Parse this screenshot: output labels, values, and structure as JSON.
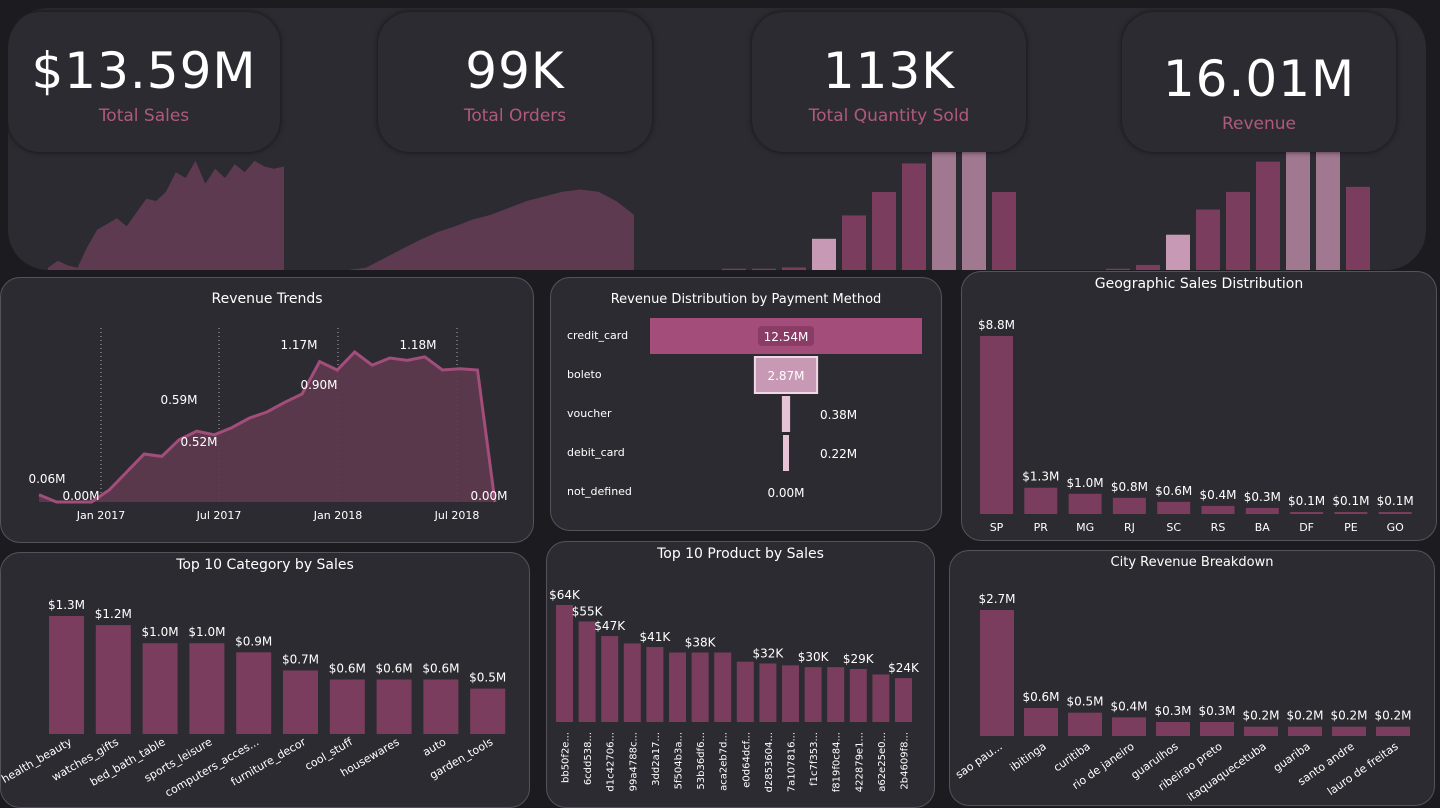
{
  "colors": {
    "bar": "#7a3d5e",
    "bar_light": "#b67d9e",
    "accent": "#b0597f",
    "area": "#5e3a50",
    "line": "#a24d7a",
    "panel": "#2c2b31"
  },
  "kpis": [
    {
      "value": "$13.59M",
      "label": "Total Sales"
    },
    {
      "value": "99K",
      "label": "Total Orders"
    },
    {
      "value": "113K",
      "label": "Total Quantity Sold"
    },
    {
      "value": "16.01M",
      "label": "Revenue"
    }
  ],
  "revenue_trends": {
    "title": "Revenue Trends",
    "x_ticks": [
      "Jan 2017",
      "Jul 2017",
      "Jan 2018",
      "Jul 2018"
    ],
    "points": [
      0.06,
      0.0,
      0.0,
      0.0,
      0.1,
      0.25,
      0.4,
      0.38,
      0.52,
      0.59,
      0.56,
      0.62,
      0.7,
      0.75,
      0.83,
      0.9,
      1.17,
      1.1,
      1.25,
      1.14,
      1.2,
      1.18,
      1.21,
      1.1,
      1.11,
      1.1,
      0.0
    ],
    "labels": [
      "0.06M",
      "0.00M",
      "0.59M",
      "0.52M",
      "1.17M",
      "0.90M",
      "1.18M",
      "0.00M"
    ]
  },
  "payment": {
    "title": "Revenue Distribution by Payment Method",
    "rows": [
      {
        "method": "credit_card",
        "value": 12.54,
        "label": "12.54M"
      },
      {
        "method": "boleto",
        "value": 2.87,
        "label": "2.87M"
      },
      {
        "method": "voucher",
        "value": 0.38,
        "label": "0.38M"
      },
      {
        "method": "debit_card",
        "value": 0.22,
        "label": "0.22M"
      },
      {
        "method": "not_defined",
        "value": 0.0,
        "label": "0.00M"
      }
    ]
  },
  "geo": {
    "title": "Geographic Sales Distribution",
    "categories": [
      "SP",
      "PR",
      "MG",
      "RJ",
      "SC",
      "RS",
      "BA",
      "DF",
      "PE",
      "GO"
    ],
    "values": [
      8.8,
      1.3,
      1.0,
      0.8,
      0.6,
      0.4,
      0.3,
      0.1,
      0.1,
      0.1
    ],
    "labels": [
      "$8.8M",
      "$1.3M",
      "$1.0M",
      "$0.8M",
      "$0.6M",
      "$0.4M",
      "$0.3M",
      "$0.1M",
      "$0.1M",
      "$0.1M"
    ]
  },
  "category": {
    "title": "Top 10 Category by Sales",
    "categories": [
      "health_beauty",
      "watches_gifts",
      "bed_bath_table",
      "sports_leisure",
      "computers_acces...",
      "furniture_decor",
      "cool_stuff",
      "housewares",
      "auto",
      "garden_tools"
    ],
    "values": [
      1.3,
      1.2,
      1.0,
      1.0,
      0.9,
      0.7,
      0.6,
      0.6,
      0.6,
      0.5
    ],
    "labels": [
      "$1.3M",
      "$1.2M",
      "$1.0M",
      "$1.0M",
      "$0.9M",
      "$0.7M",
      "$0.6M",
      "$0.6M",
      "$0.6M",
      "$0.5M"
    ]
  },
  "product": {
    "title": "Top 10 Product by Sales",
    "categories": [
      "bb50f2e...",
      "6cdd538...",
      "d1c42706...",
      "99a4788c...",
      "3dd2a17...",
      "5f504b3a...",
      "53b36df6...",
      "aca2eb7d...",
      "e0d64dcf...",
      "d2853604...",
      "7a107816...",
      "f1c7f353...",
      "f819f0c84...",
      "422879e1...",
      "a62e25e0...",
      "2b4609f8..."
    ],
    "values": [
      64,
      55,
      47,
      43,
      41,
      38,
      38,
      38,
      33,
      32,
      31,
      30,
      30,
      29,
      26,
      24
    ],
    "labels": [
      "$64K",
      "$55K",
      "$47K",
      "",
      "$41K",
      "",
      "$38K",
      "",
      "",
      "$32K",
      "",
      "$30K",
      "",
      "$29K",
      "",
      "$24K"
    ]
  },
  "city": {
    "title": "City Revenue Breakdown",
    "categories": [
      "sao pau...",
      "ibitinga",
      "curitiba",
      "rio de janeiro",
      "guarulhos",
      "ribeirao preto",
      "itaquaquecetuba",
      "guariba",
      "santo andre",
      "lauro de freitas"
    ],
    "values": [
      2.7,
      0.6,
      0.5,
      0.4,
      0.3,
      0.3,
      0.2,
      0.2,
      0.2,
      0.2
    ],
    "labels": [
      "$2.7M",
      "$0.6M",
      "$0.5M",
      "$0.4M",
      "$0.3M",
      "$0.3M",
      "$0.2M",
      "$0.2M",
      "$0.2M",
      "$0.2M"
    ]
  },
  "sparks": {
    "sales_area": [
      0.02,
      0.08,
      0.04,
      0.02,
      0.2,
      0.35,
      0.4,
      0.45,
      0.38,
      0.5,
      0.62,
      0.6,
      0.68,
      0.85,
      0.8,
      0.95,
      0.75,
      0.88,
      0.8,
      0.92,
      0.85,
      0.95,
      0.9,
      0.88,
      0.9
    ],
    "orders_area": [
      0.0,
      0.02,
      0.1,
      0.18,
      0.26,
      0.33,
      0.38,
      0.44,
      0.48,
      0.54,
      0.6,
      0.64,
      0.68,
      0.7,
      0.68,
      0.6,
      0.48
    ],
    "qty_bars": [
      0.01,
      0.01,
      0.02,
      0.24,
      0.42,
      0.6,
      0.82,
      1.0,
      0.94,
      0.6
    ],
    "rev_bars": [
      0.01,
      0.04,
      0.28,
      0.48,
      0.62,
      0.86,
      1.0,
      1.04,
      0.66
    ]
  }
}
